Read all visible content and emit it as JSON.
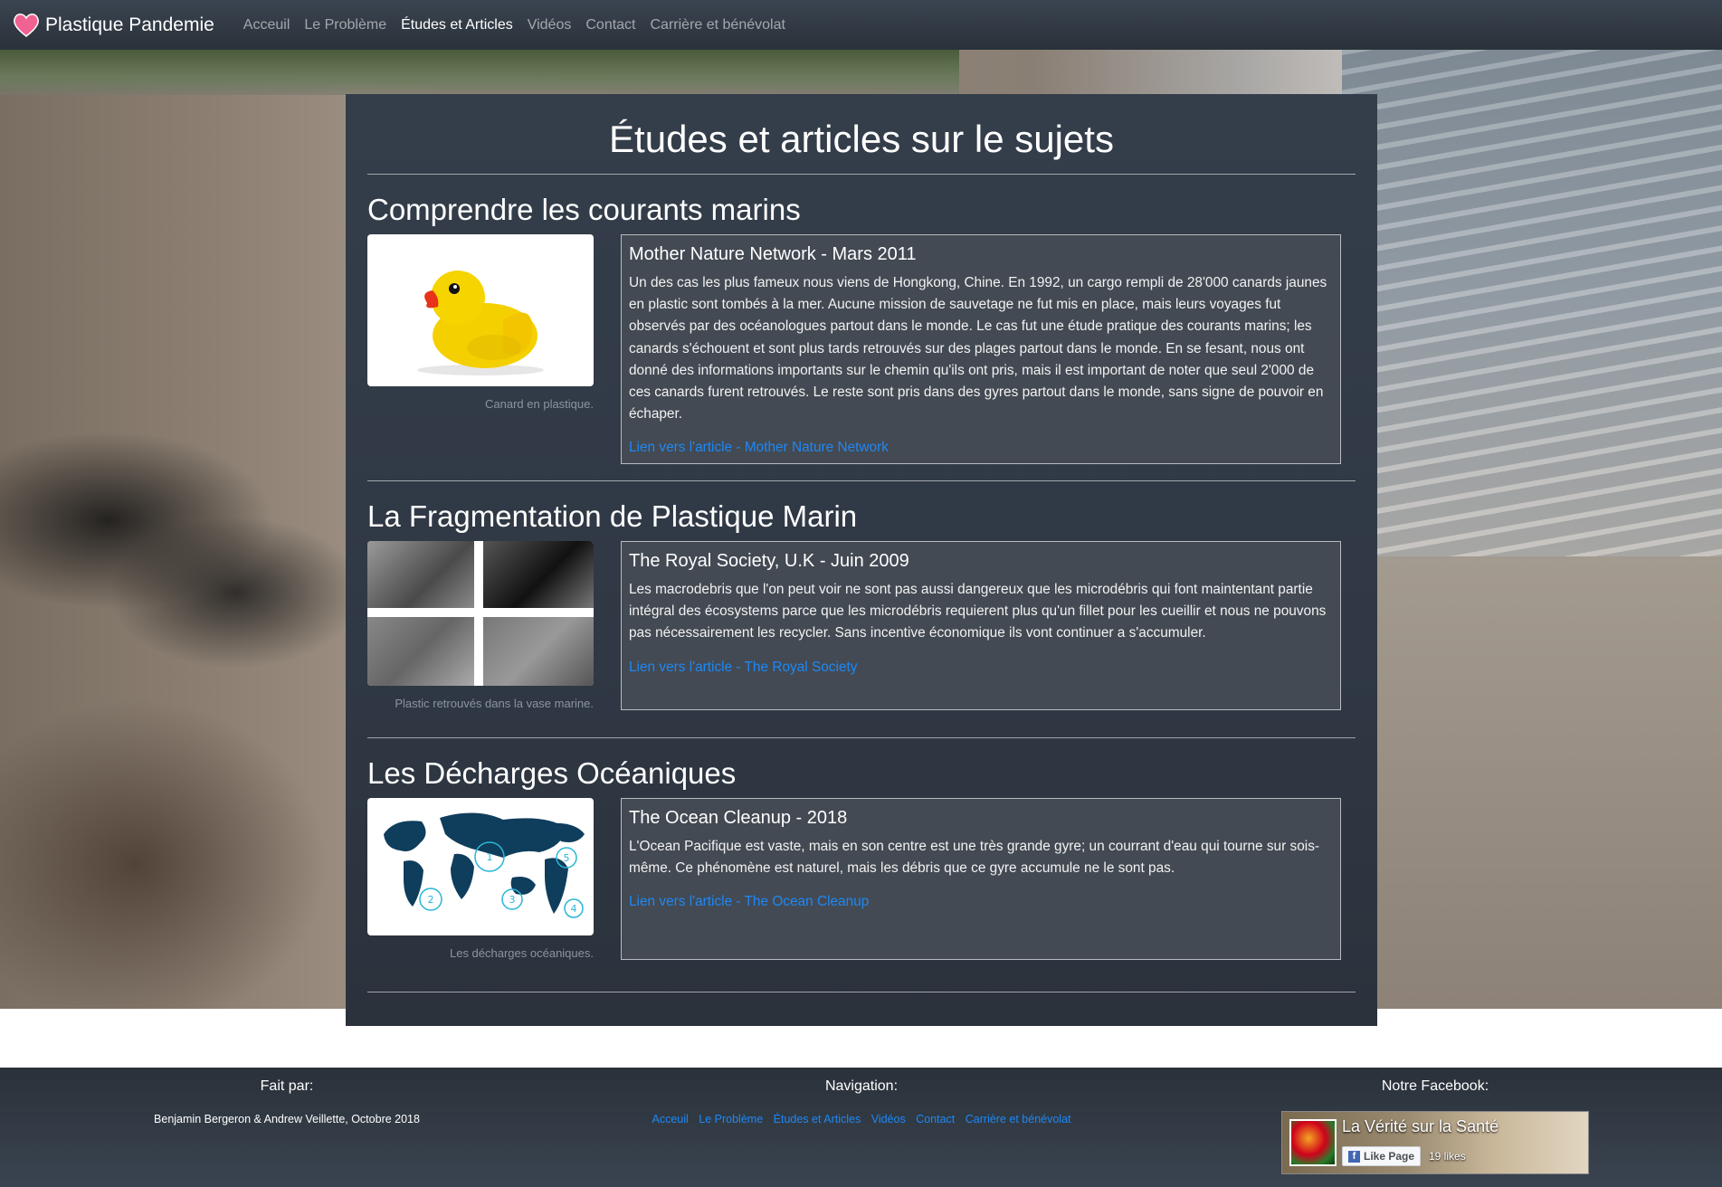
{
  "navbar": {
    "brand": "Plastique Pandemie",
    "links": [
      {
        "label": "Acceuil"
      },
      {
        "label": "Le Problème"
      },
      {
        "label": "Études et Articles"
      },
      {
        "label": "Vidéos"
      },
      {
        "label": "Contact"
      },
      {
        "label": "Carrière et bénévolat"
      }
    ],
    "active_index": 2
  },
  "page_title": "Études et articles sur le sujets",
  "sections": [
    {
      "title": "Comprendre les courants marins",
      "image_icon": "rubber-duck",
      "caption": "Canard en plastique.",
      "card_title": "Mother Nature Network - Mars 2011",
      "card_text": "Un des cas les plus fameux nous viens de Hongkong, Chine. En 1992, un cargo rempli de 28'000 canards jaunes en plastic sont tombés à la mer. Aucune mission de sauvetage ne fut mis en place, mais leurs voyages fut observés par des océanologues partout dans le monde. Le cas fut une étude pratique des courants marins; les canards s'échouent et sont plus tards retrouvés sur des plages partout dans le monde. En se fesant, nous ont donné des informations importants sur le chemin qu'ils ont pris, mais il est important de noter que seul 2'000 de ces canards furent retrouvés. Le reste sont pris dans des gyres partout dans le monde, sans signe de pouvoir en échaper.",
      "link": "Lien vers l'article - Mother Nature Network"
    },
    {
      "title": "La Fragmentation de Plastique Marin",
      "image_icon": "microscope-photos",
      "caption": "Plastic retrouvés dans la vase marine.",
      "card_title": "The Royal Society, U.K - Juin 2009",
      "card_text": "Les macrodebris que l'on peut voir ne sont pas aussi dangereux que les microdébris qui font maintentant partie intégral des écosystems parce que les microdébris requierent plus qu'un fillet pour les cueillir et nous ne pouvons pas nécessairement les recycler. Sans incentive économique ils vont continuer a s'accumuler.",
      "link": "Lien vers l'article - The Royal Society"
    },
    {
      "title": "Les Décharges Océaniques",
      "image_icon": "world-gyres-map",
      "caption": "Les décharges océaniques.",
      "card_title": "The Ocean Cleanup - 2018",
      "card_text": "L'Ocean Pacifique est vaste, mais en son centre est une très grande gyre; un courrant d'eau qui tourne sur sois-même. Ce phénomène est naturel, mais les débris que ce gyre accumule ne le sont pas.",
      "link": "Lien vers l'article - The Ocean Cleanup"
    }
  ],
  "map_labels": [
    "1",
    "2",
    "3",
    "4",
    "5"
  ],
  "footer": {
    "made_by_heading": "Fait par:",
    "made_by_text": "Benjamin Bergeron & Andrew Veillette, Octobre 2018",
    "nav_heading": "Navigation:",
    "nav_links": [
      "Acceuil",
      "Le Problème",
      "Études et Articles",
      "Vidéos",
      "Contact",
      "Carrière et bénévolat"
    ],
    "facebook_heading": "Notre Facebook:",
    "facebook": {
      "page_name": "La Vérité sur la Santé",
      "like_label": "Like Page",
      "likes": "19 likes"
    }
  },
  "colors": {
    "link": "#1e88f5",
    "panel": "#343e4a",
    "card": "#434a53",
    "navbar": "#2a313a",
    "heart": "#f06292"
  }
}
